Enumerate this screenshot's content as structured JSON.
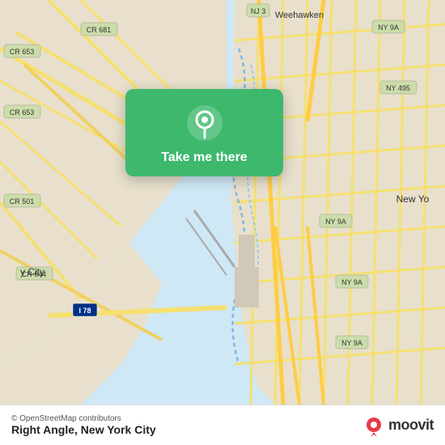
{
  "map": {
    "popup": {
      "label": "Take me there",
      "icon": "location-pin"
    },
    "credit": "© OpenStreetMap contributors",
    "location": "Right Angle, New York City"
  },
  "branding": {
    "name": "moovit"
  }
}
